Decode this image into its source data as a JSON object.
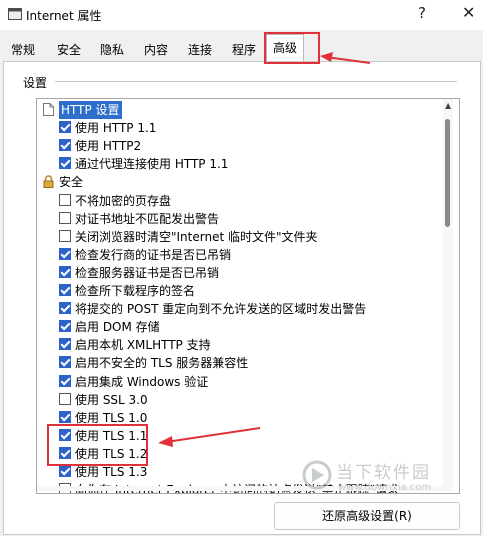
{
  "window": {
    "title": "Internet 属性",
    "help_glyph": "?",
    "close_glyph": "✕"
  },
  "tabs": [
    {
      "label": "常规"
    },
    {
      "label": "安全"
    },
    {
      "label": "隐私"
    },
    {
      "label": "内容"
    },
    {
      "label": "连接"
    },
    {
      "label": "程序"
    },
    {
      "label": "高级",
      "active": true
    }
  ],
  "settings_group_label": "设置",
  "settings_items": [
    {
      "type": "section",
      "icon": "page-icon",
      "label": "HTTP 设置"
    },
    {
      "type": "checkbox",
      "checked": true,
      "label": "使用 HTTP 1.1"
    },
    {
      "type": "checkbox",
      "checked": true,
      "label": "使用 HTTP2"
    },
    {
      "type": "checkbox",
      "checked": true,
      "label": "通过代理连接使用 HTTP 1.1"
    },
    {
      "type": "section",
      "icon": "lock-icon",
      "label": "安全"
    },
    {
      "type": "checkbox",
      "checked": false,
      "label": "不将加密的页存盘"
    },
    {
      "type": "checkbox",
      "checked": false,
      "label": "对证书地址不匹配发出警告"
    },
    {
      "type": "checkbox",
      "checked": false,
      "label": "关闭浏览器时清空\"Internet 临时文件\"文件夹"
    },
    {
      "type": "checkbox",
      "checked": true,
      "label": "检查发行商的证书是否已吊销"
    },
    {
      "type": "checkbox",
      "checked": true,
      "label": "检查服务器证书是否已吊销"
    },
    {
      "type": "checkbox",
      "checked": true,
      "label": "检查所下载程序的签名"
    },
    {
      "type": "checkbox",
      "checked": true,
      "label": "将提交的 POST 重定向到不允许发送的区域时发出警告"
    },
    {
      "type": "checkbox",
      "checked": true,
      "label": "启用 DOM 存储"
    },
    {
      "type": "checkbox",
      "checked": true,
      "label": "启用本机 XMLHTTP 支持"
    },
    {
      "type": "checkbox",
      "checked": true,
      "label": "启用不安全的 TLS 服务器兼容性"
    },
    {
      "type": "checkbox",
      "checked": true,
      "label": "启用集成 Windows 验证"
    },
    {
      "type": "checkbox",
      "checked": false,
      "label": "使用 SSL 3.0"
    },
    {
      "type": "checkbox",
      "checked": true,
      "label": "使用 TLS 1.0"
    },
    {
      "type": "checkbox",
      "checked": true,
      "label": "使用 TLS 1.1"
    },
    {
      "type": "checkbox",
      "checked": true,
      "label": "使用 TLS 1.2"
    },
    {
      "type": "checkbox",
      "checked": true,
      "label": "使用 TLS 1.3"
    },
    {
      "type": "checkbox",
      "checked": false,
      "label": "向你在 Internet Explorer 中访问的站点发送\"禁止跟踪\"请求"
    }
  ],
  "restore_button_label": "还原高级设置(R)",
  "watermark": {
    "name": "当下软件园",
    "url": "www.downxia.com"
  },
  "colors": {
    "checkbox_on": "#2d63c8",
    "selection": "#2f6fcc",
    "annotation": "#e0303a"
  }
}
